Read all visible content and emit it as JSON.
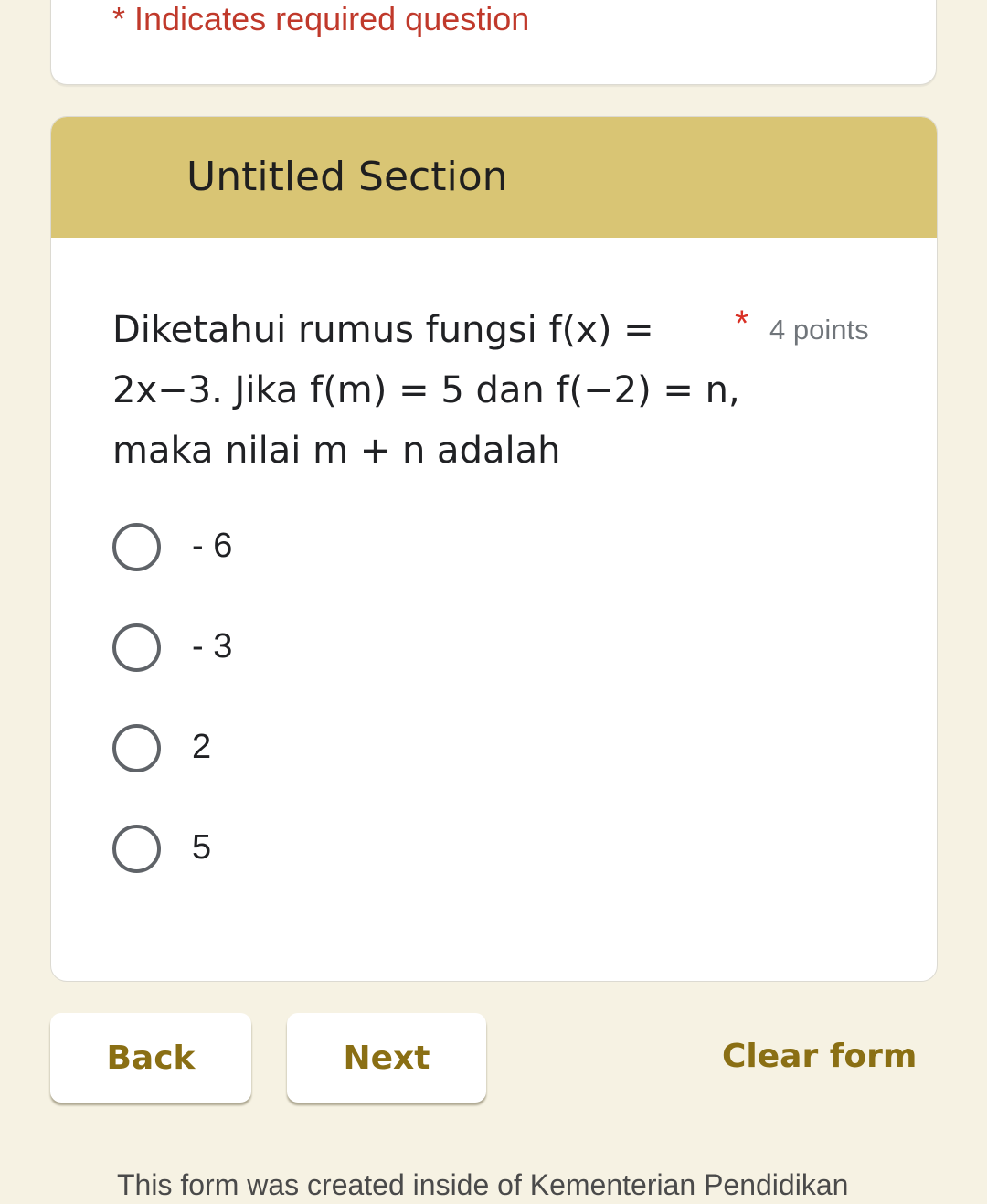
{
  "header_card": {
    "required_note": "* Indicates required question"
  },
  "section": {
    "title": "Untitled Section",
    "header_color": "#d9c574",
    "question": {
      "text": "Diketahui rumus fungsi f(x) = 2x−3. Jika f(m) = 5 dan f(−2) = n, maka nilai m + n adalah",
      "required_marker": "*",
      "points": "4 points",
      "options": [
        {
          "label": "- 6",
          "selected": false
        },
        {
          "label": "- 3",
          "selected": false
        },
        {
          "label": "2",
          "selected": false
        },
        {
          "label": "5",
          "selected": false
        }
      ]
    }
  },
  "navigation": {
    "back_label": "Back",
    "next_label": "Next",
    "clear_label": "Clear form",
    "accent_color": "#8a6f14"
  },
  "footer": {
    "note": "This form was created inside of Kementerian Pendidikan"
  }
}
